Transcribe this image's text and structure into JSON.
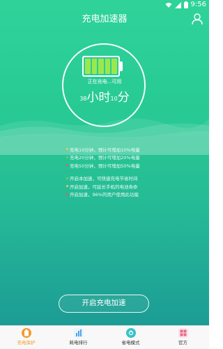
{
  "status_bar": {
    "time": "9:56",
    "icons": [
      "wifi-icon",
      "signal-icon",
      "battery-icon"
    ]
  },
  "header": {
    "title": "充电加速器",
    "right_icon": "user-icon"
  },
  "battery": {
    "cells": 5,
    "status_text": "正在充电...可用",
    "hours": "38",
    "hours_label": "小时",
    "minutes": "10",
    "minutes_label": "分"
  },
  "info": {
    "estimates": [
      {
        "text": "充电10分钟，预计可增加10%电量",
        "color": "#f6c84a"
      },
      {
        "text": "充电20分钟，预计可增加20%电量",
        "color": "#7ad04e"
      },
      {
        "text": "充电50分钟，预计可增加50%电量",
        "color": "#e85b5b"
      }
    ],
    "tips": [
      {
        "text": "开启本加速，可快速充电节省时间",
        "color": "#7ad04e"
      },
      {
        "text": "开启加速，可延长手机的电池寿命",
        "color": "#f6c84a"
      },
      {
        "text": "开启加速，96%的用户使用此功能",
        "color": "#e85b5b"
      }
    ]
  },
  "cta": {
    "label": "开启充电加速"
  },
  "tabbar": {
    "tabs": [
      {
        "label": "充电保护",
        "icon": "battery-protect-icon",
        "color": "#f29b2e"
      },
      {
        "label": "耗电排行",
        "icon": "ranking-icon",
        "color": "#4da3e8"
      },
      {
        "label": "省电模式",
        "icon": "power-save-icon",
        "color": "#37c2c9"
      },
      {
        "label": "官方",
        "icon": "official-icon",
        "color": "#e86b8a"
      }
    ]
  },
  "colors": {
    "primary_green": "#2fd39a",
    "bottom_teal": "#1c9c95",
    "battery_cell": "#9be84e",
    "active_tab": "#f29b2e"
  }
}
